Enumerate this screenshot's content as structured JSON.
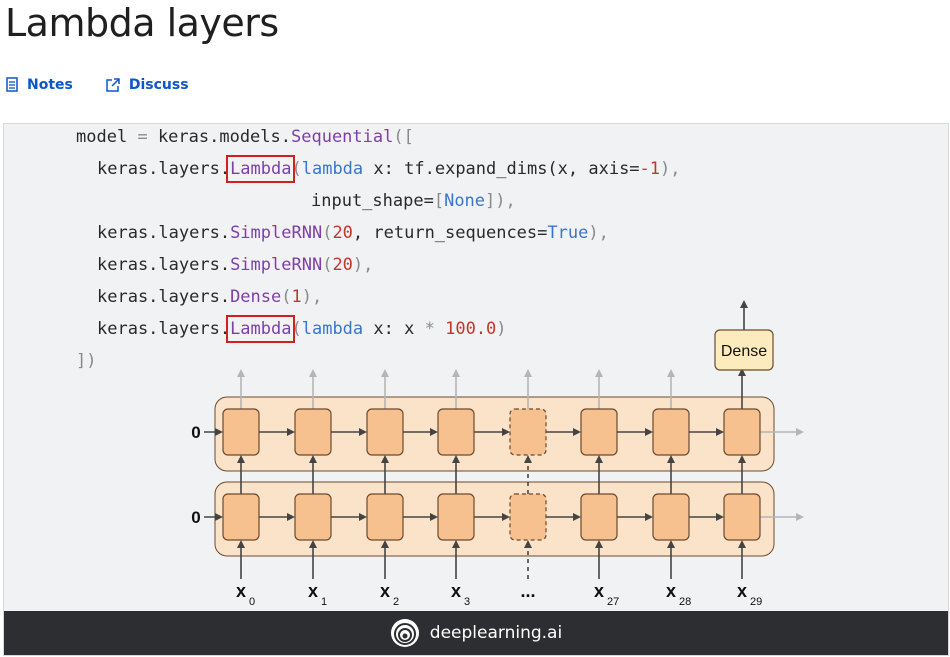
{
  "page": {
    "title": "Lambda layers",
    "links": [
      {
        "label": "Notes",
        "icon": "notes-icon"
      },
      {
        "label": "Discuss",
        "icon": "external-link-icon"
      }
    ]
  },
  "code": {
    "line1_model": "model",
    "line1_eq": "=",
    "line1_prefix": "keras.models.",
    "line1_seq": "Sequential",
    "line1_bracket": "([",
    "layer_prefix": "keras.layers.",
    "lambda": "Lambda",
    "line2_rest_a": "(",
    "line2_lambda_kw": "lambda",
    "line2_x": "x:",
    "line2_expr": "tf.expand_dims(x, axis=",
    "line2_num": "-1",
    "line2_end": "),",
    "line3_a": "input_shape=",
    "line3_b": "[",
    "line3_none": "None",
    "line3_c": "]),",
    "line4_name": "SimpleRNN",
    "line4_a": "(",
    "line4_num": "20",
    "line4_b": ", return_sequences=",
    "line4_true": "True",
    "line4_c": "),",
    "line5_name": "SimpleRNN",
    "line5_a": "(",
    "line5_num": "20",
    "line5_b": "),",
    "line6_name": "Dense",
    "line6_a": "(",
    "line6_num": "1",
    "line6_b": "),",
    "line7_a": "(",
    "line7_lambda_kw": "lambda",
    "line7_x": "x: x",
    "line7_op": "*",
    "line7_num": "100.0",
    "line7_b": ")",
    "line8": "])"
  },
  "diagram": {
    "initial_state": "0",
    "dense_label": "Dense",
    "inputs": [
      "x",
      "x",
      "x",
      "x",
      "...",
      "x",
      "x",
      "x"
    ],
    "input_subscripts": [
      "0",
      "1",
      "2",
      "3",
      "",
      "27",
      "28",
      "29"
    ],
    "colors": {
      "cell_fill": "#f7c08f",
      "cell_stroke": "#6b4a2f",
      "layer_fill": "#fbe3ca",
      "dense_fill": "#fcebbd",
      "arrow_dark": "#444444",
      "arrow_light": "#b5b5b5"
    }
  },
  "footer": {
    "brand": "deeplearning.ai",
    "icon": "deeplearning-logo-icon"
  }
}
